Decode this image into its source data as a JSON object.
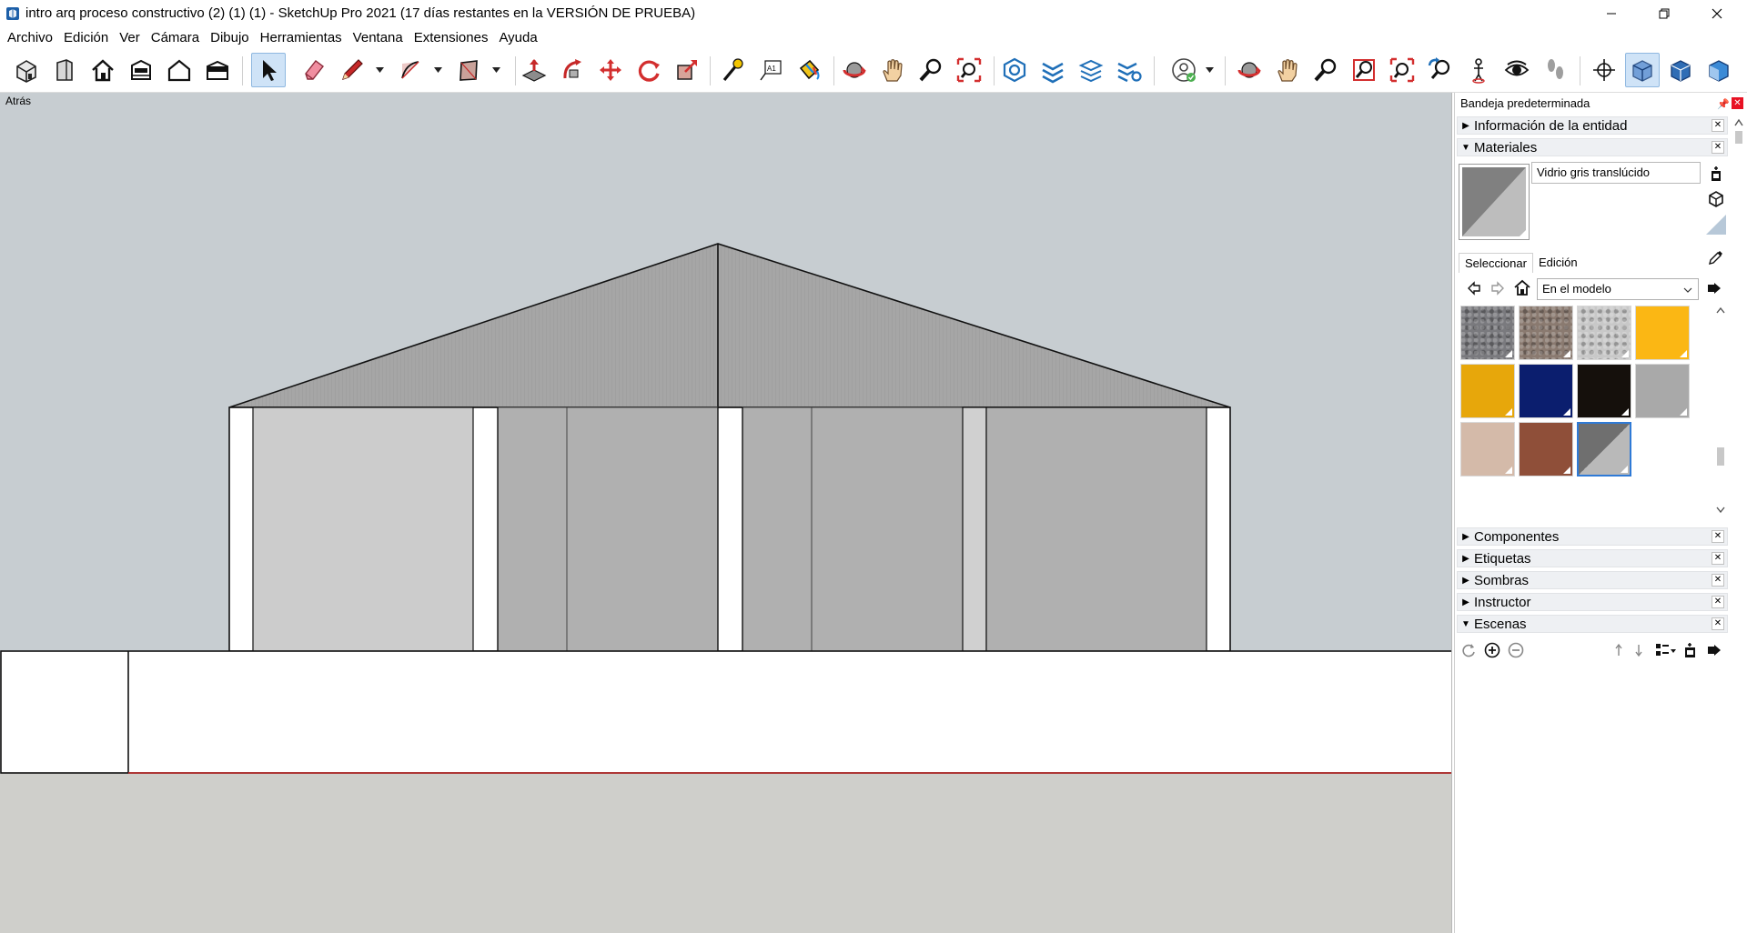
{
  "window": {
    "title": "intro arq proceso constructivo (2) (1) (1) - SketchUp Pro 2021 (17 días restantes en la VERSIÓN DE PRUEBA)"
  },
  "menu": [
    "Archivo",
    "Edición",
    "Ver",
    "Cámara",
    "Dibujo",
    "Herramientas",
    "Ventana",
    "Extensiones",
    "Ayuda"
  ],
  "toolbar": {
    "tools": [
      "iso-view-icon",
      "front-view-icon",
      "home-icon",
      "top-view-icon",
      "house-outline-icon",
      "back-view-icon",
      "select-arrow-icon",
      "eraser-icon",
      "pencil-icon",
      "arc-icon",
      "rectangle-icon",
      "push-pull-icon",
      "follow-me-icon",
      "move-icon",
      "rotate-icon",
      "scale-icon",
      "tape-measure-icon",
      "text-label-icon",
      "paint-bucket-icon",
      "orbit-icon",
      "pan-icon",
      "zoom-icon",
      "zoom-extents-icon",
      "warehouse-icon",
      "extension-warehouse-icon",
      "layout-icon",
      "extension-manager-icon",
      "profile-icon",
      "orbit-2-icon",
      "pan-2-icon",
      "zoom-2-icon",
      "zoom-window-icon",
      "zoom-extents-2-icon",
      "previous-view-icon",
      "position-camera-icon",
      "look-around-icon",
      "walk-icon",
      "axes-icon",
      "xray-icon",
      "wireframe-icon",
      "shaded-icon"
    ]
  },
  "viewport": {
    "scene_tab": "Atrás",
    "colors": {
      "sky": "#c7cdd1",
      "ground": "#cfcfcb",
      "wall": "#ffffff",
      "roof": "#a6a6a6",
      "glass": "#b0b0b0"
    }
  },
  "tray": {
    "title": "Bandeja predeterminada",
    "panels": {
      "entity_info": "Información de la entidad",
      "materials": "Materiales",
      "components": "Componentes",
      "tags": "Etiquetas",
      "shadows": "Sombras",
      "instructor": "Instructor",
      "scenes": "Escenas"
    },
    "materials": {
      "current_name": "Vidrio gris translúcido",
      "tabs": [
        "Seleccionar",
        "Edición"
      ],
      "library": "En el modelo",
      "swatches": [
        {
          "name": "granite-dark",
          "color": "#7a7a7e"
        },
        {
          "name": "granite-brown",
          "color": "#8a7a70"
        },
        {
          "name": "granite-light",
          "color": "#c8c8c8"
        },
        {
          "name": "yellow",
          "color": "#fbb714"
        },
        {
          "name": "orange-yellow",
          "color": "#e7a70b"
        },
        {
          "name": "navy",
          "color": "#0b1e6e"
        },
        {
          "name": "black",
          "color": "#15100c"
        },
        {
          "name": "gray",
          "color": "#a9a9a9"
        },
        {
          "name": "beige",
          "color": "#d4baa9"
        },
        {
          "name": "brick",
          "color": "#8f4f39"
        },
        {
          "name": "glass-gray",
          "color": "#808080"
        }
      ]
    }
  }
}
